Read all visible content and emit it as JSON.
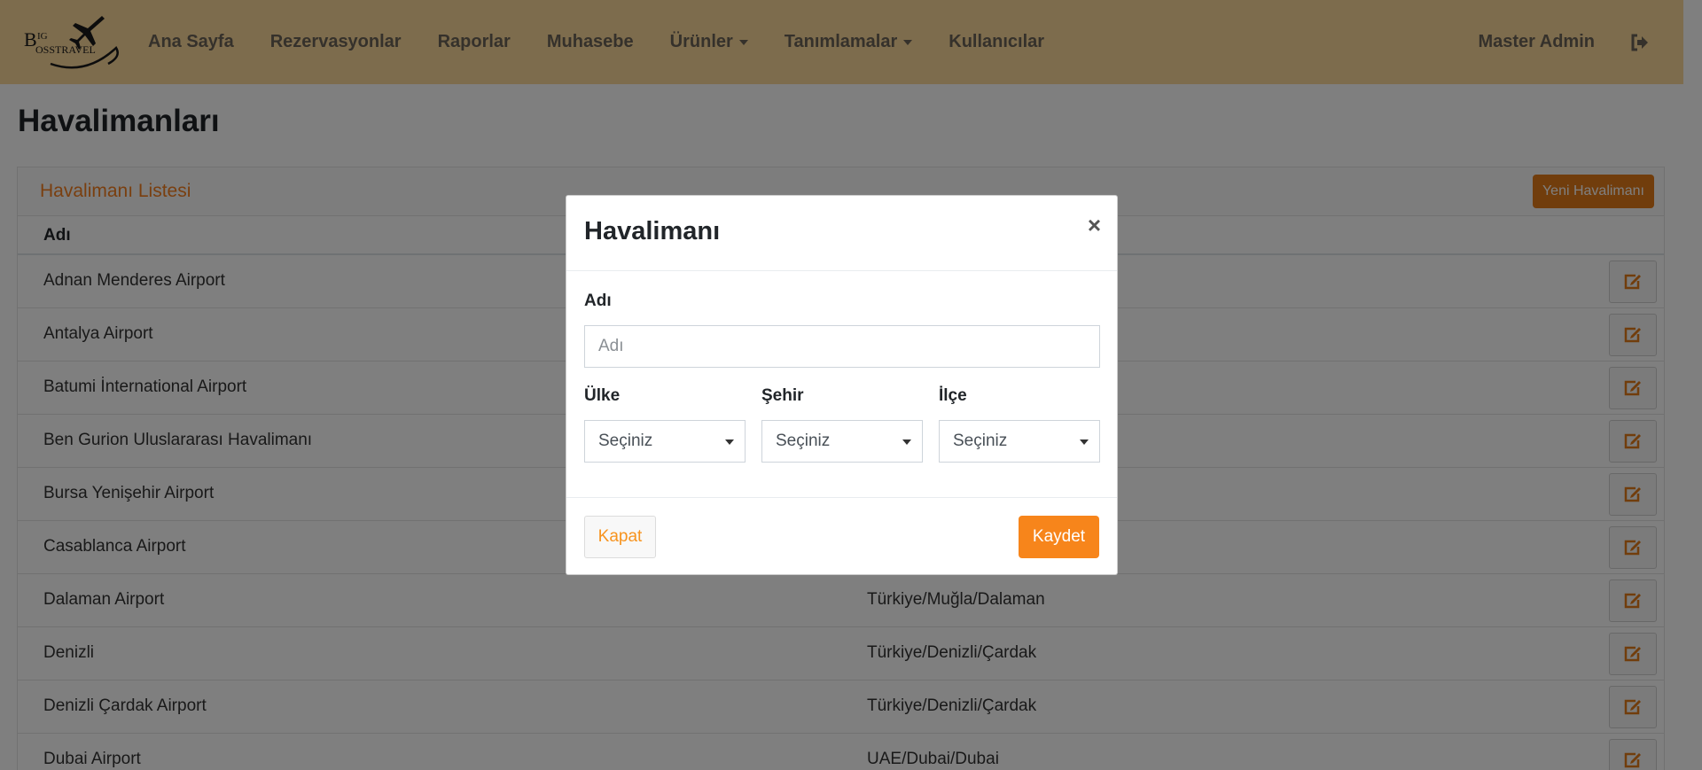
{
  "navbar": {
    "logo_text": "BIG BOSS TRAVEL",
    "links": [
      {
        "label": "Ana Sayfa",
        "dropdown": false
      },
      {
        "label": "Rezervasyonlar",
        "dropdown": false
      },
      {
        "label": "Raporlar",
        "dropdown": false
      },
      {
        "label": "Muhasebe",
        "dropdown": false
      },
      {
        "label": "Ürünler",
        "dropdown": true
      },
      {
        "label": "Tanımlamalar",
        "dropdown": true
      },
      {
        "label": "Kullanıcılar",
        "dropdown": false
      }
    ],
    "user_name": "Master Admin",
    "logout_icon": "sign-out-icon"
  },
  "page": {
    "title": "Havalimanları"
  },
  "card": {
    "title": "Havalimanı Listesi",
    "new_button_label": "Yeni Havalimanı",
    "columns": [
      "Adı"
    ],
    "rows": [
      {
        "name": "Adnan Menderes Airport",
        "location": ""
      },
      {
        "name": "Antalya Airport",
        "location": ""
      },
      {
        "name": "Batumi İnternational Airport",
        "location": ""
      },
      {
        "name": "Ben Gurion Uluslararası Havalimanı",
        "location": ""
      },
      {
        "name": "Bursa Yenişehir Airport",
        "location": ""
      },
      {
        "name": "Casablanca Airport",
        "location": ""
      },
      {
        "name": "Dalaman Airport",
        "location": "Türkiye/Muğla/Dalaman"
      },
      {
        "name": "Denizli",
        "location": "Türkiye/Denizli/Çardak"
      },
      {
        "name": "Denizli Çardak Airport",
        "location": "Türkiye/Denizli/Çardak"
      },
      {
        "name": "Dubai Airport",
        "location": "UAE/Dubai/Dubai"
      }
    ],
    "edit_icon": "edit-icon"
  },
  "modal": {
    "title": "Havalimanı",
    "close_symbol": "×",
    "name_label": "Adı",
    "name_placeholder": "Adı",
    "name_value": "",
    "country_label": "Ülke",
    "country_value": "Seçiniz",
    "city_label": "Şehir",
    "city_value": "Seçiniz",
    "district_label": "İlçe",
    "district_value": "Seçiniz",
    "close_button_label": "Kapat",
    "save_button_label": "Kaydet"
  },
  "colors": {
    "navbar_bg": "#fbd89b",
    "accent": "#f7851b",
    "new_button": "#e37a19",
    "card_title": "#f47e1f"
  }
}
